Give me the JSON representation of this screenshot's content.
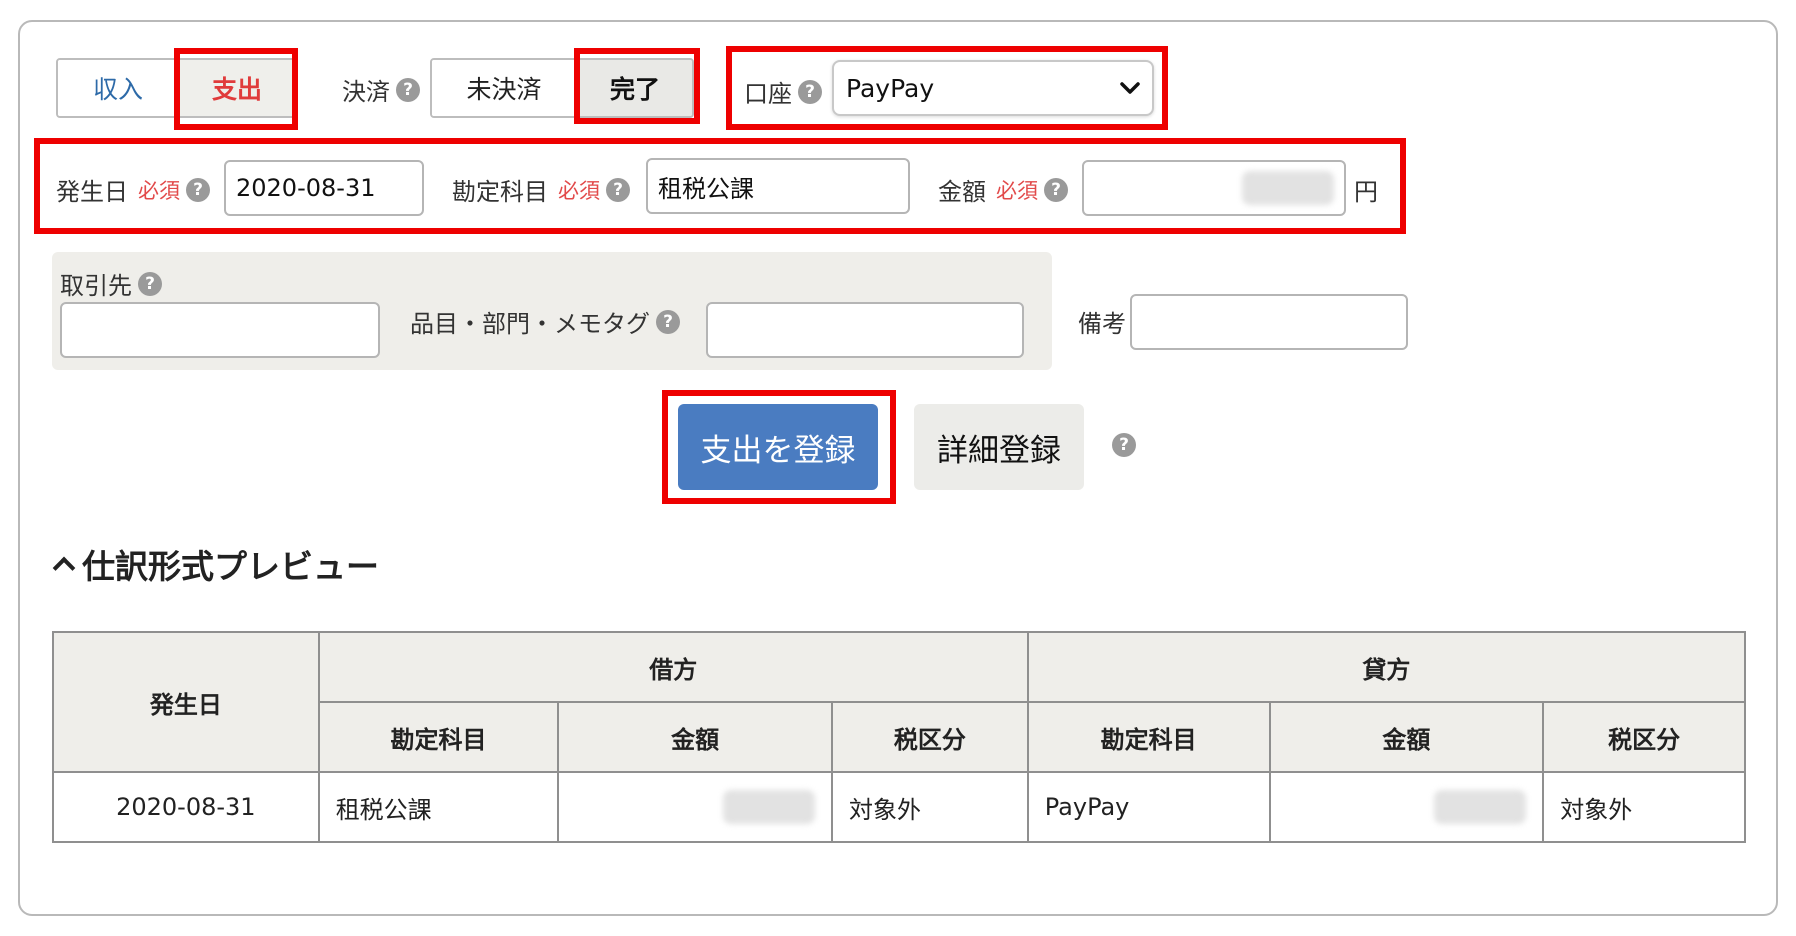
{
  "type_toggle": {
    "income": "収入",
    "expense": "支出",
    "selected": "支出"
  },
  "settlement": {
    "label": "決済",
    "unsettled": "未決済",
    "done": "完了",
    "selected": "完了"
  },
  "account": {
    "label": "口座",
    "value": "PayPay"
  },
  "date_field": {
    "label": "発生日",
    "required": "必須",
    "value": "2020-08-31"
  },
  "account_item": {
    "label": "勘定科目",
    "required": "必須",
    "value": "租税公課"
  },
  "amount": {
    "label": "金額",
    "required": "必須",
    "unit": "円"
  },
  "partner": {
    "label": "取引先"
  },
  "tags": {
    "label": "品目・部門・メモタグ"
  },
  "memo": {
    "label": "備考"
  },
  "buttons": {
    "register": "支出を登録",
    "detail": "詳細登録"
  },
  "help_glyph": "?",
  "preview": {
    "title": "仕訳形式プレビュー",
    "headers": {
      "date": "発生日",
      "debit": "借方",
      "credit": "貸方",
      "account": "勘定科目",
      "amount": "金額",
      "tax": "税区分"
    },
    "row": {
      "date": "2020-08-31",
      "debit_account": "租税公課",
      "debit_tax": "対象外",
      "credit_account": "PayPay",
      "credit_tax": "対象外"
    }
  },
  "colors": {
    "highlight": "#ee0000",
    "primary_button": "#4a7cc1",
    "expense_text": "#e03b3b",
    "income_text": "#2d6aa8"
  }
}
